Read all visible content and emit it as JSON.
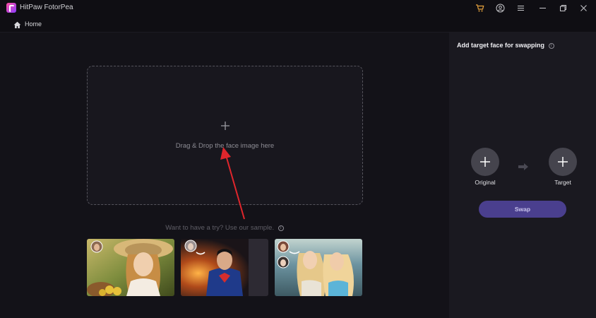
{
  "app": {
    "title": "HitPaw FotorPea"
  },
  "nav": {
    "home_label": "Home"
  },
  "dropzone": {
    "text": "Drag & Drop the face image here"
  },
  "samples": {
    "hint": "Want to have a try? Use our sample.",
    "items": [
      {
        "description": "woman-with-straw-hat"
      },
      {
        "description": "superhero"
      },
      {
        "description": "two-women-at-beach"
      }
    ]
  },
  "panel": {
    "title": "Add target face for swapping",
    "original_label": "Original",
    "target_label": "Target",
    "swap_label": "Swap"
  },
  "colors": {
    "accent": "#4a3f8e",
    "background": "#131218",
    "panel": "#1a1920"
  }
}
